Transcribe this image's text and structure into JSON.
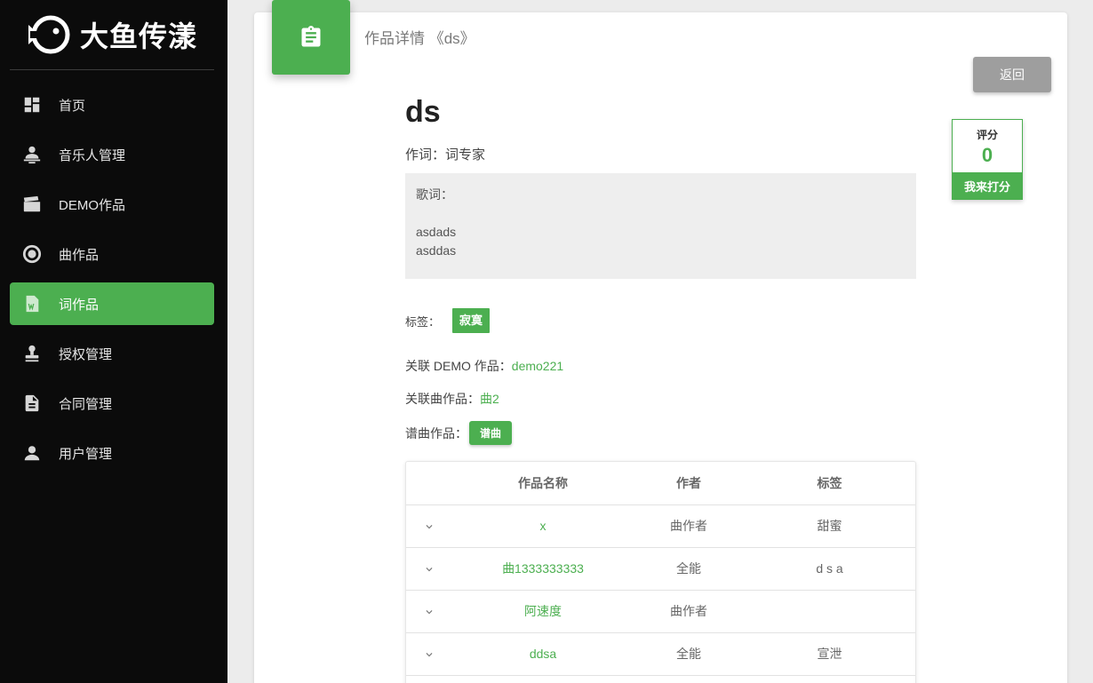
{
  "brand": {
    "name": "大鱼传漾"
  },
  "sidebar": {
    "items": [
      {
        "label": "首页",
        "icon": "dashboard-icon"
      },
      {
        "label": "音乐人管理",
        "icon": "musician-icon"
      },
      {
        "label": "DEMO作品",
        "icon": "clapperboard-icon"
      },
      {
        "label": "曲作品",
        "icon": "record-icon"
      },
      {
        "label": "词作品",
        "icon": "word-file-icon",
        "active": true
      },
      {
        "label": "授权管理",
        "icon": "stamp-icon"
      },
      {
        "label": "合同管理",
        "icon": "document-icon"
      },
      {
        "label": "用户管理",
        "icon": "user-icon"
      }
    ]
  },
  "header": {
    "title": "作品详情 《ds》",
    "back_label": "返回"
  },
  "work": {
    "title": "ds",
    "lyricist_label": "作词：",
    "lyricist": "词专家",
    "lyrics_label": "歌词：",
    "lyrics_lines": [
      "asdads",
      "asddas"
    ],
    "tags_label": "标签：",
    "tag": "寂寞",
    "demo_label": "关联 DEMO 作品：",
    "demo_link": "demo221",
    "music_label": "关联曲作品：",
    "music_link": "曲2",
    "compose_label": "谱曲作品：",
    "compose_button": "谱曲"
  },
  "rating": {
    "label": "评分",
    "value": "0",
    "button": "我来打分"
  },
  "table": {
    "headers": [
      "作品名称",
      "作者",
      "标签"
    ],
    "rows": [
      {
        "name": "x",
        "author": "曲作者",
        "tag": "甜蜜"
      },
      {
        "name": "曲1333333333",
        "author": "全能",
        "tag": "d s a"
      },
      {
        "name": "阿速度",
        "author": "曲作者",
        "tag": ""
      },
      {
        "name": "ddsa",
        "author": "全能",
        "tag": "宣泄"
      }
    ]
  },
  "colors": {
    "accent": "#4caf50",
    "sidebar_bg": "#0b0b0b",
    "back_button": "#9e9e9e"
  }
}
